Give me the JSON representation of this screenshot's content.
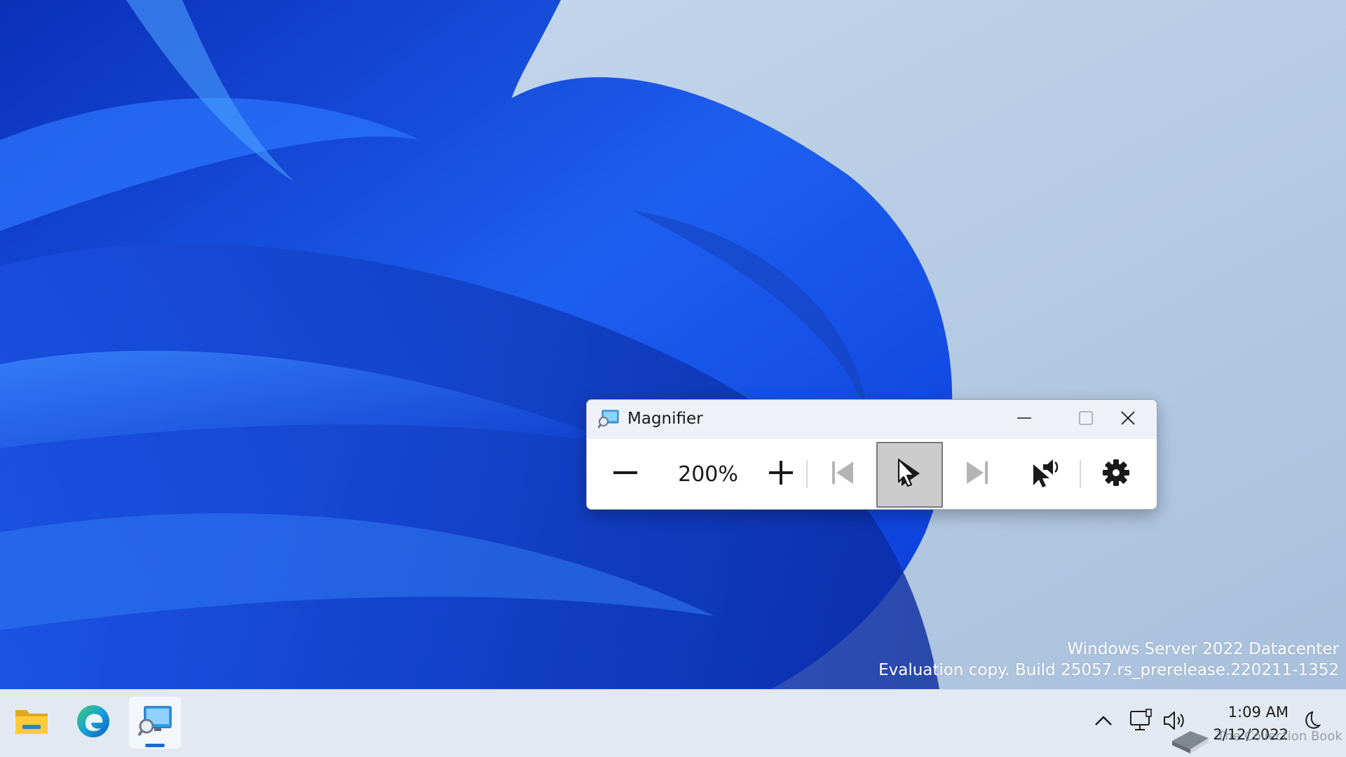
{
  "desktop": {
    "watermark_line1": "Windows Server 2022 Datacenter",
    "watermark_line2": "Evaluation copy. Build 25057.rs_prerelease.220211-1352"
  },
  "magnifier": {
    "title": "Magnifier",
    "zoom_level": "200%",
    "icons": {
      "app": "magnifier-app-icon",
      "minimize": "minimize-icon",
      "maximize": "maximize-icon",
      "close": "close-icon",
      "zoom_out": "minus-icon",
      "zoom_in": "plus-icon",
      "previous": "skip-previous-icon",
      "read_from_here": "pointer-play-icon",
      "next": "skip-next-icon",
      "read_aloud": "pointer-speaker-icon",
      "settings": "gear-icon"
    },
    "pressed_color": "#cccccc"
  },
  "taskbar": {
    "apps": [
      "file-explorer-icon",
      "edge-icon",
      "magnifier-icon"
    ],
    "active_app": "magnifier",
    "accent": "#1669d6",
    "tray": {
      "icons": [
        "chevron-up-icon",
        "network-icon",
        "volume-icon",
        "focus-moon-icon"
      ],
      "time": "1:09 AM",
      "date": "2/12/2022"
    }
  },
  "overlay": {
    "text": "The Collection Book"
  }
}
